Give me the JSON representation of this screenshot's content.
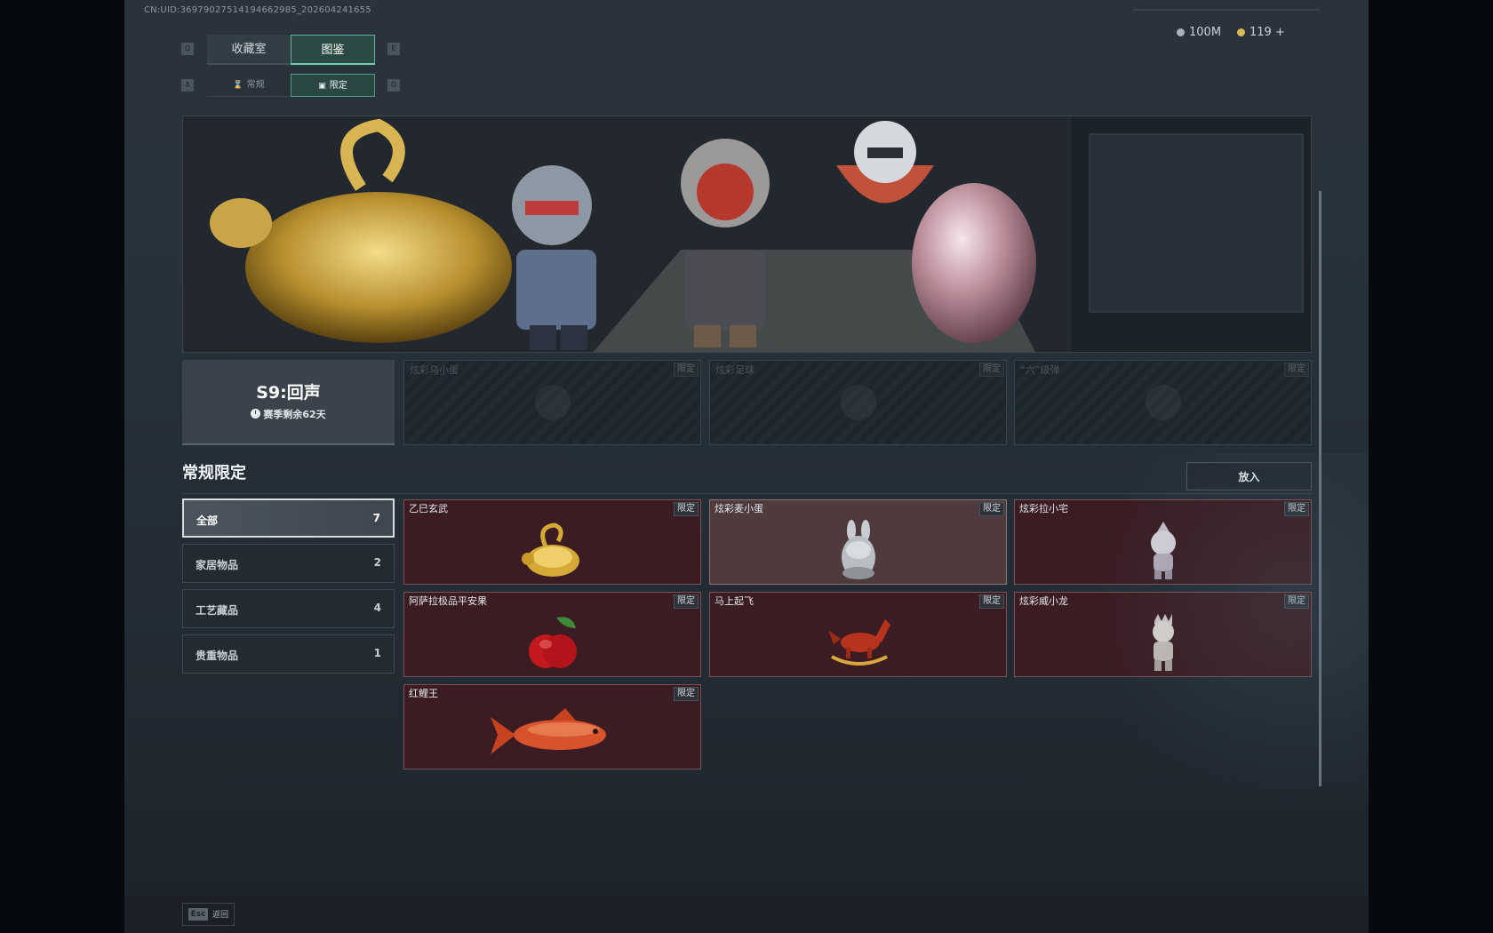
{
  "uid_text": "CN:UID:36979027514194662985_202604241655",
  "tabs": {
    "prev_key": "Q",
    "next_key": "E",
    "items": [
      "收藏室",
      "图鉴"
    ],
    "active_index": 1
  },
  "subtabs": {
    "prev_key": "A",
    "next_key": "D",
    "items": [
      "常规",
      "限定"
    ],
    "active_index": 1
  },
  "currency": {
    "silver": "100M",
    "gold": "119 +"
  },
  "season": {
    "title": "S9:回声",
    "remaining": "赛季剩余62天"
  },
  "locked_slots": [
    {
      "name": "炫彩乌小蛋",
      "tag": "限定"
    },
    {
      "name": "炫彩足球",
      "tag": "限定"
    },
    {
      "name": "“六”级弹",
      "tag": "限定"
    }
  ],
  "section": {
    "title": "常规限定",
    "put_button": "放入"
  },
  "categories": [
    {
      "label": "全部",
      "count": "7"
    },
    {
      "label": "家居物品",
      "count": "2"
    },
    {
      "label": "工艺藏品",
      "count": "4"
    },
    {
      "label": "贵重物品",
      "count": "1"
    }
  ],
  "items": [
    {
      "name": "乙巳玄武",
      "tag": "限定",
      "icon": "golden-turtle-icon"
    },
    {
      "name": "炫彩麦小蛋",
      "tag": "限定",
      "icon": "rabbit-egg-icon"
    },
    {
      "name": "炫彩拉小宅",
      "tag": "限定",
      "icon": "chibi-figure-icon"
    },
    {
      "name": "阿萨拉极品平安果",
      "tag": "限定",
      "icon": "apple-icon"
    },
    {
      "name": "马上起飞",
      "tag": "限定",
      "icon": "rocking-horse-icon"
    },
    {
      "name": "炫彩威小龙",
      "tag": "限定",
      "icon": "dragon-figure-icon"
    },
    {
      "name": "红鲤王",
      "tag": "限定",
      "icon": "koi-fish-icon"
    }
  ],
  "footer": {
    "key": "Esc",
    "label": "返回"
  },
  "colors": {
    "accent": "#6fd0b0",
    "item_bg": "#3a1c22",
    "item_border": "#7a5258"
  }
}
